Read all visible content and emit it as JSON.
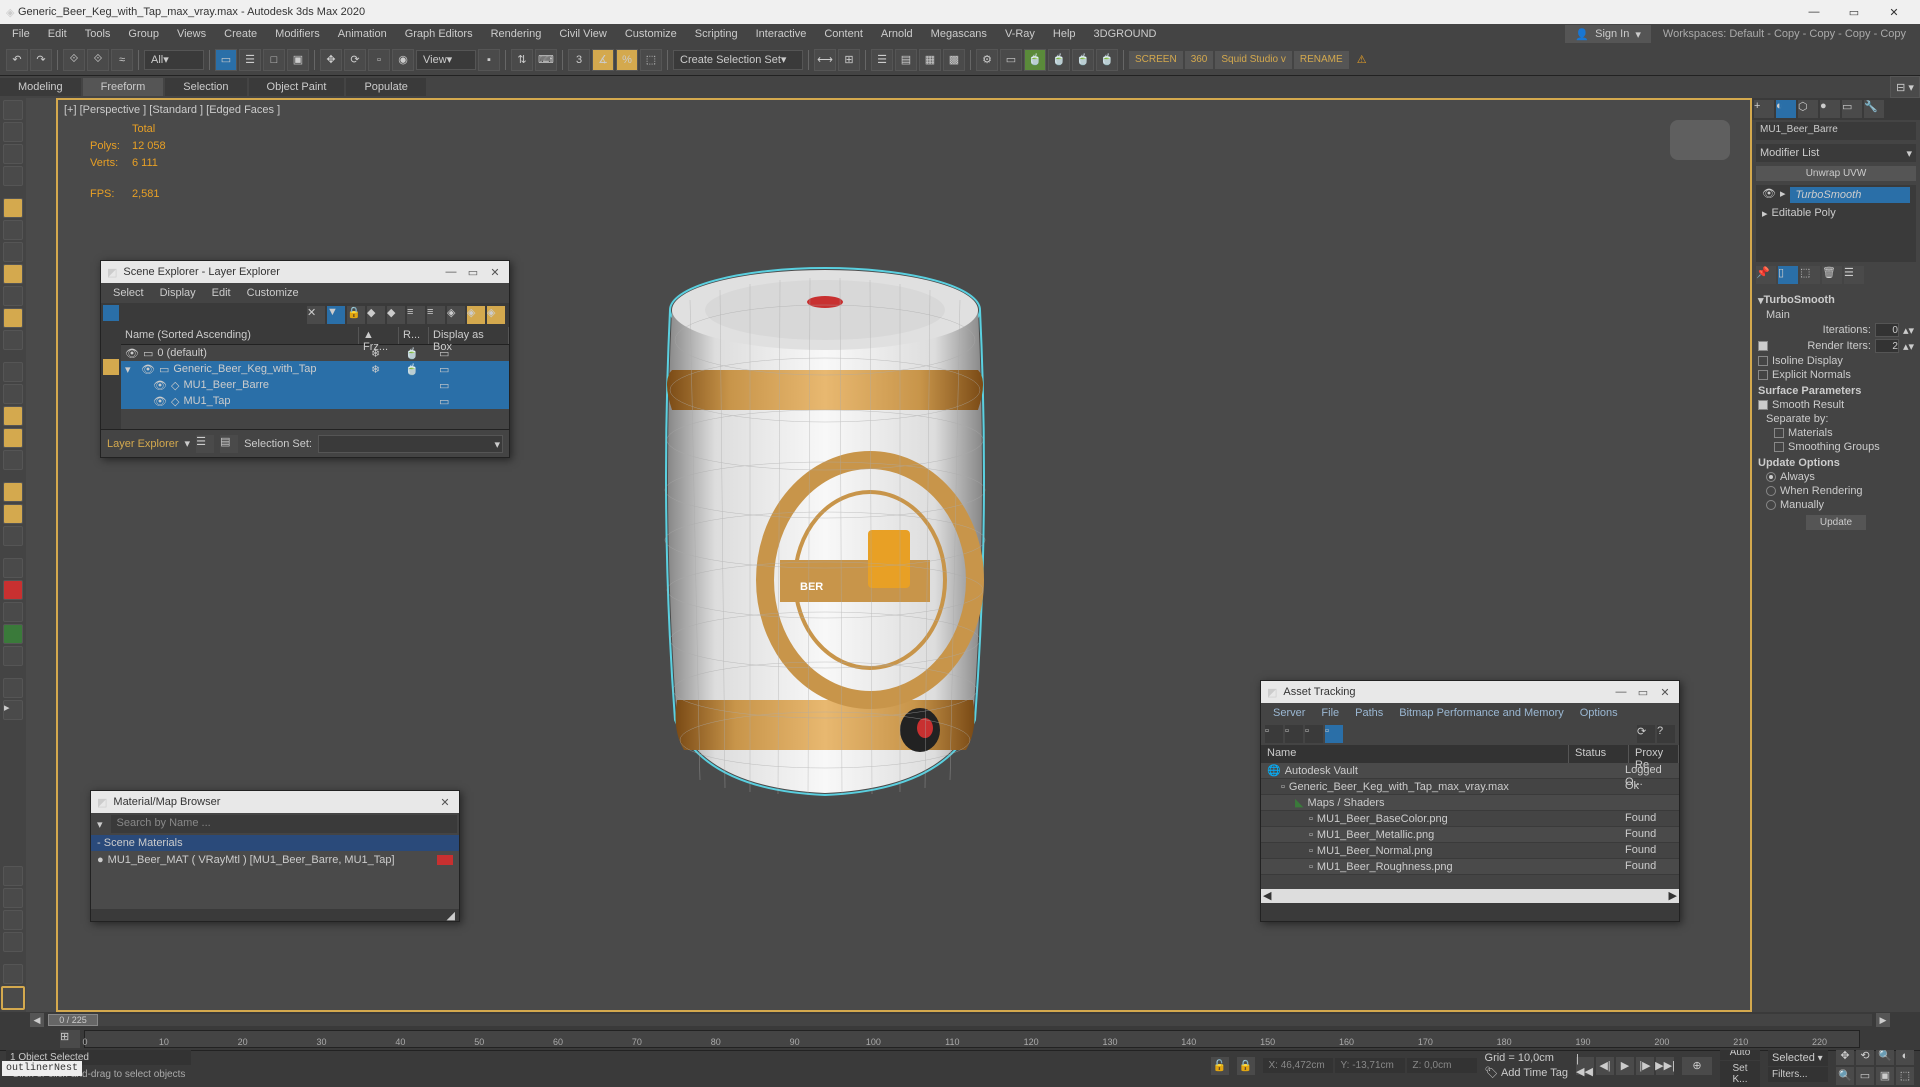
{
  "titlebar": {
    "title": "Generic_Beer_Keg_with_Tap_max_vray.max - Autodesk 3ds Max 2020"
  },
  "menu": {
    "items": [
      "File",
      "Edit",
      "Tools",
      "Group",
      "Views",
      "Create",
      "Modifiers",
      "Animation",
      "Graph Editors",
      "Rendering",
      "Civil View",
      "Customize",
      "Scripting",
      "Interactive",
      "Content",
      "Arnold",
      "Megascans",
      "V-Ray",
      "Help",
      "3DGROUND"
    ],
    "signin": "Sign In",
    "workspaces": "Workspaces: Default - Copy - Copy - Copy - Copy"
  },
  "toolbar": {
    "all": "All",
    "view": "View",
    "createset": "Create Selection Set",
    "screen": "SCREEN",
    "angle": "360",
    "squid": "Squid Studio v",
    "rename": "RENAME"
  },
  "ribbon": {
    "tabs": [
      "Modeling",
      "Freeform",
      "Selection",
      "Object Paint",
      "Populate"
    ],
    "active": 1
  },
  "viewport": {
    "label": "[+] [Perspective ] [Standard ] [Edged Faces ]",
    "stats": {
      "total": "Total",
      "polys_l": "Polys:",
      "polys": "12 058",
      "verts_l": "Verts:",
      "verts": "6 111",
      "fps_l": "FPS:",
      "fps": "2,581"
    }
  },
  "sceneExplorer": {
    "title": "Scene Explorer - Layer Explorer",
    "menu": [
      "Select",
      "Display",
      "Edit",
      "Customize"
    ],
    "cols": {
      "name": "Name (Sorted Ascending)",
      "frz": "▲ Frz...",
      "r": "R...",
      "disp": "Display as Box"
    },
    "rows": [
      {
        "indent": 0,
        "label": "0 (default)"
      },
      {
        "indent": 1,
        "label": "Generic_Beer_Keg_with_Tap",
        "sel": true
      },
      {
        "indent": 2,
        "label": "MU1_Beer_Barre",
        "sel": true
      },
      {
        "indent": 2,
        "label": "MU1_Tap",
        "sel": true
      }
    ],
    "footer": {
      "label": "Layer Explorer",
      "selset": "Selection Set:"
    }
  },
  "materialBrowser": {
    "title": "Material/Map Browser",
    "search": "Search by Name ...",
    "section": "Scene Materials",
    "item": "MU1_Beer_MAT ( VRayMtl ) [MU1_Beer_Barre, MU1_Tap]"
  },
  "assetTracking": {
    "title": "Asset Tracking",
    "menu": [
      "Server",
      "File",
      "Paths",
      "Bitmap Performance and Memory",
      "Options"
    ],
    "cols": {
      "name": "Name",
      "status": "Status",
      "proxy": "Proxy Re"
    },
    "rows": [
      {
        "icon": "globe",
        "name": "Autodesk Vault",
        "status": "Logged O..."
      },
      {
        "icon": "file",
        "name": "Generic_Beer_Keg_with_Tap_max_vray.max",
        "status": "Ok",
        "indent": 1
      },
      {
        "icon": "folder",
        "name": "Maps / Shaders",
        "indent": 2
      },
      {
        "icon": "map",
        "name": "MU1_Beer_BaseColor.png",
        "status": "Found",
        "indent": 3
      },
      {
        "icon": "map",
        "name": "MU1_Beer_Metallic.png",
        "status": "Found",
        "indent": 3
      },
      {
        "icon": "map",
        "name": "MU1_Beer_Normal.png",
        "status": "Found",
        "indent": 3
      },
      {
        "icon": "map",
        "name": "MU1_Beer_Roughness.png",
        "status": "Found",
        "indent": 3
      }
    ]
  },
  "cmdpanel": {
    "objname": "MU1_Beer_Barre",
    "modlist": "Modifier List",
    "unwrap": "Unwrap UVW",
    "stack": [
      {
        "name": "TurboSmooth",
        "sel": true
      },
      {
        "name": "Editable Poly"
      }
    ],
    "rollout": {
      "title": "TurboSmooth",
      "main": "Main",
      "iter_l": "Iterations:",
      "iter": "0",
      "rend_l": "Render Iters:",
      "rend": "2",
      "rend_on": true,
      "isoline": "Isoline Display",
      "explicit": "Explicit Normals",
      "surf": "Surface Parameters",
      "smooth": "Smooth Result",
      "smooth_on": true,
      "sep": "Separate by:",
      "mat": "Materials",
      "smg": "Smoothing Groups",
      "upd": "Update Options",
      "always": "Always",
      "when": "When Rendering",
      "manual": "Manually",
      "update": "Update"
    }
  },
  "timeslider": {
    "frame": "0 / 225"
  },
  "timeline": {
    "ticks": [
      0,
      10,
      20,
      30,
      40,
      50,
      60,
      70,
      80,
      90,
      100,
      110,
      120,
      130,
      140,
      150,
      160,
      170,
      180,
      190,
      200,
      210,
      220
    ]
  },
  "status": {
    "selected": "1 Object Selected",
    "prompt": "Click or click-and-drag to select objects",
    "x": "X: 46,472cm",
    "y": "Y: -13,71cm",
    "z": "Z: 0,0cm",
    "grid": "Grid = 10,0cm",
    "tag": "Add Time Tag",
    "auto": "Auto",
    "setk": "Set K...",
    "selected2": "Selected",
    "filters": "Filters..."
  },
  "maxscript": "outlinerNest"
}
